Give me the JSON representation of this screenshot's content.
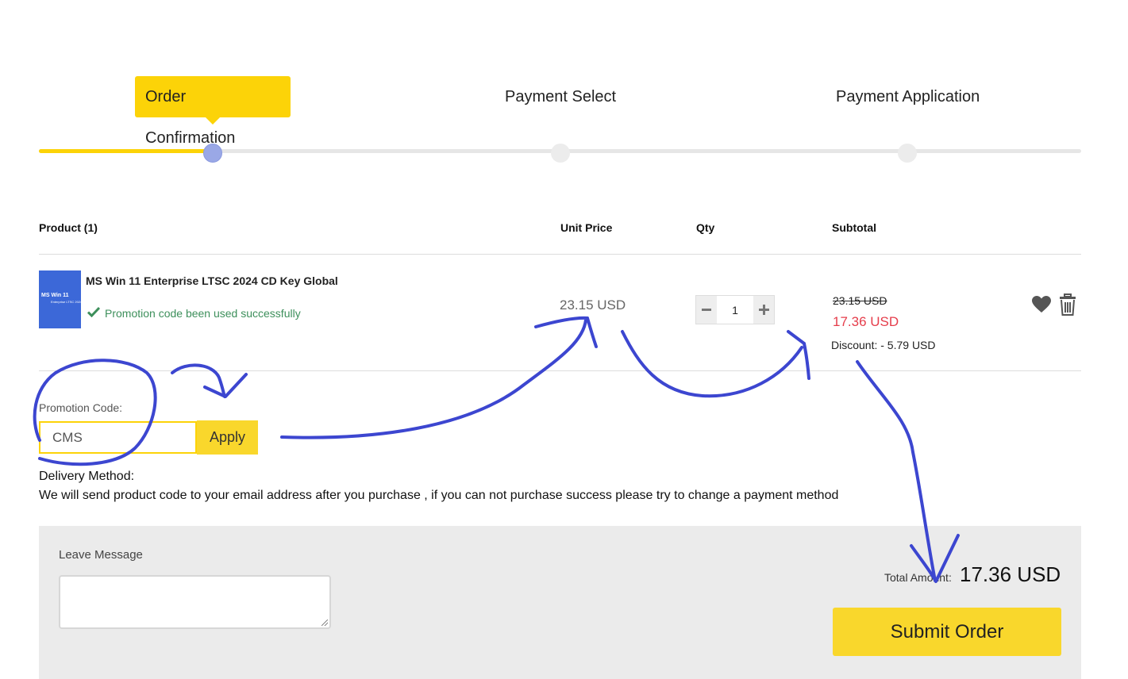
{
  "steps": [
    {
      "label": "Order Confirmation",
      "active": true
    },
    {
      "label": "Payment Select",
      "active": false
    },
    {
      "label": "Payment Application",
      "active": false
    }
  ],
  "table": {
    "headers": {
      "product": "Product (1)",
      "unit_price": "Unit Price",
      "qty": "Qty",
      "subtotal": "Subtotal"
    }
  },
  "product": {
    "thumb_line1": "MS Win 11",
    "thumb_line2": "Enterprise LTSC 2024",
    "name": "MS Win 11 Enterprise LTSC 2024 CD Key Global",
    "promo_status": "Promotion code been used successfully",
    "unit_price": "23.15 USD",
    "qty": "1",
    "old_subtotal": "23.15 USD",
    "subtotal": "17.36 USD",
    "discount": "Discount: - 5.79 USD"
  },
  "promotion": {
    "label": "Promotion Code:",
    "value": "CMS",
    "apply_label": "Apply"
  },
  "delivery": {
    "label": "Delivery Method:",
    "text": "We will send product code to your email address after you purchase , if you can not purchase success please try to change a payment method"
  },
  "footer": {
    "message_label": "Leave Message",
    "message_value": "",
    "total_label": "Total Amount:",
    "total_value": "17.36 USD",
    "submit_label": "Submit Order"
  },
  "colors": {
    "accent": "#fcd308",
    "active_dot": "#9aa8e6",
    "price_red": "#e53d4b",
    "success_green": "#3d8f5b",
    "annotation_ink": "#3c46d0"
  }
}
